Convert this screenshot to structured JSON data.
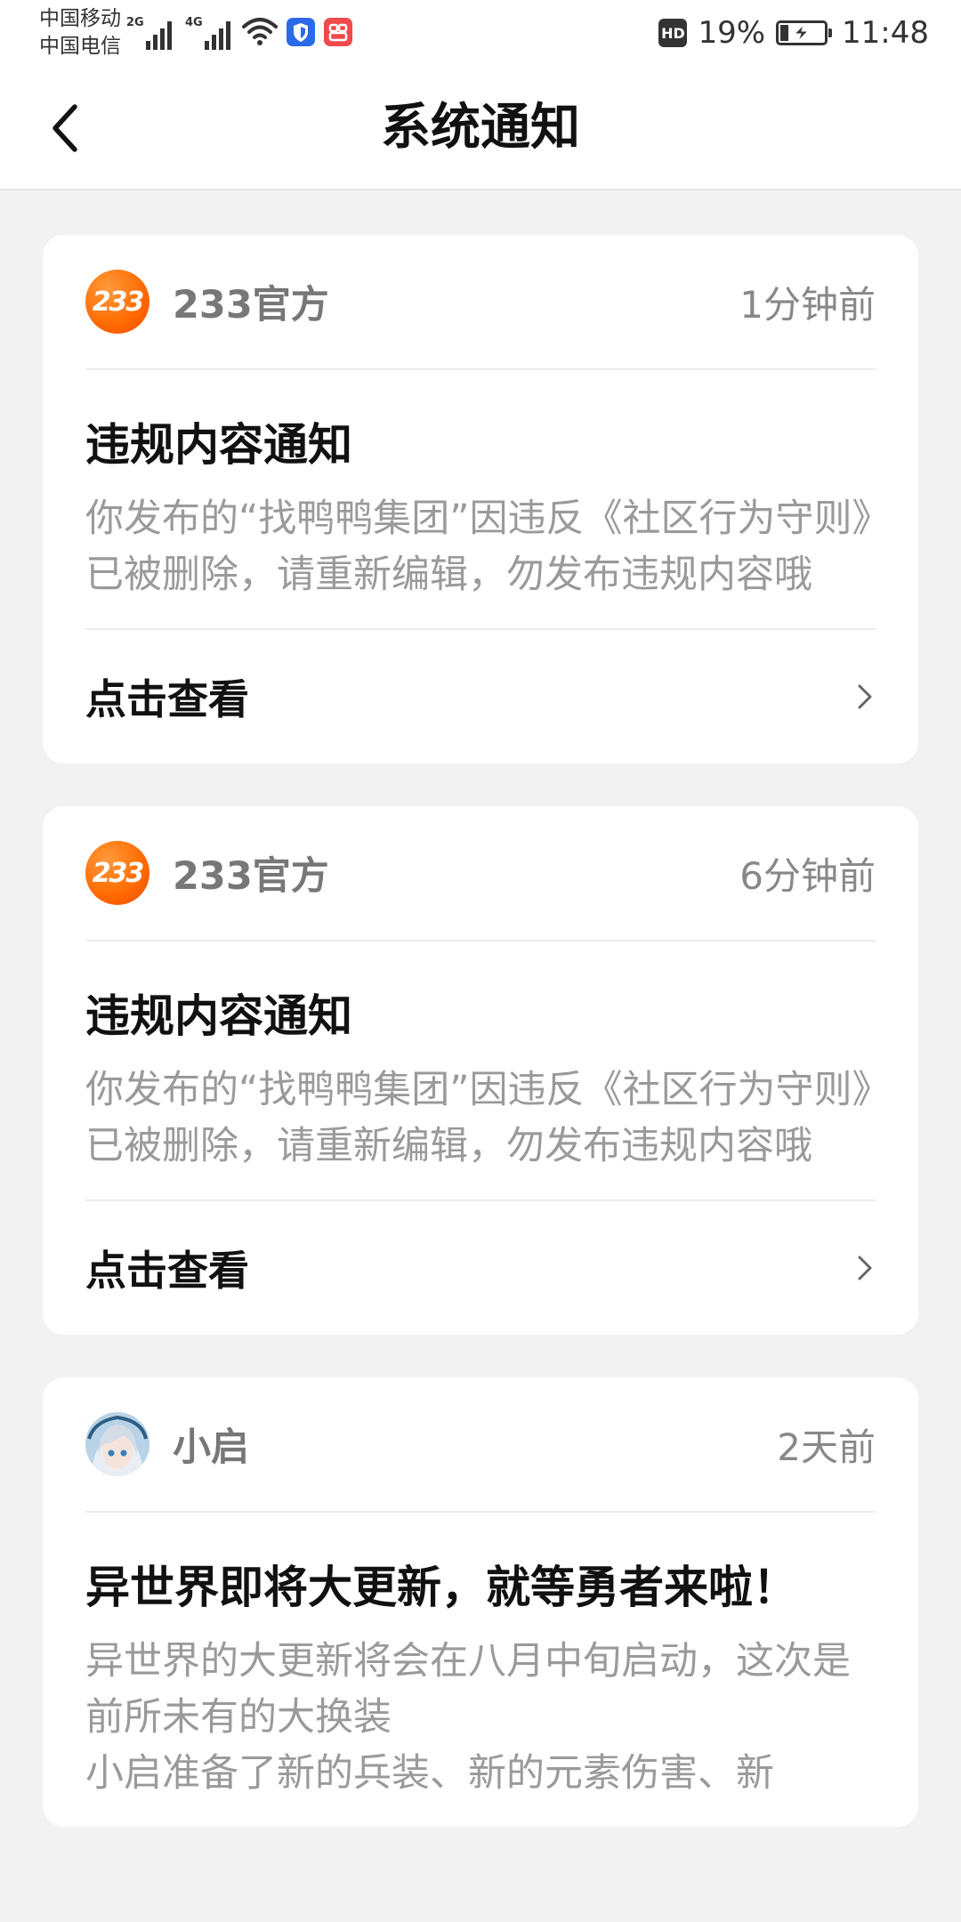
{
  "status_bar": {
    "carrier_1": "中国移动",
    "carrier_2": "中国电信",
    "net_1": "2G",
    "net_2": "4G",
    "hd": "HD",
    "battery_percent": "19%",
    "battery_level": 0.19,
    "time": "11:48"
  },
  "header": {
    "title": "系统通知"
  },
  "notifications": [
    {
      "sender": "233官方",
      "avatar_text": "233",
      "time": "1分钟前",
      "title": "违规内容通知",
      "body": "你发布的“找鸭鸭集团”因违反《社区行为守则》已被删除，请重新编辑，勿发布违规内容哦",
      "action": "点击查看"
    },
    {
      "sender": "233官方",
      "avatar_text": "233",
      "time": "6分钟前",
      "title": "违规内容通知",
      "body": "你发布的“找鸭鸭集团”因违反《社区行为守则》已被删除，请重新编辑，勿发布违规内容哦",
      "action": "点击查看"
    },
    {
      "sender": "小启",
      "time": "2天前",
      "title": "异世界即将大更新，就等勇者来啦！",
      "body_line_1": "异世界的大更新将会在八月中旬启动，这次是前所未有的大换装",
      "body_line_2": "小启准备了新的兵装、新的元素伤害、新"
    }
  ]
}
